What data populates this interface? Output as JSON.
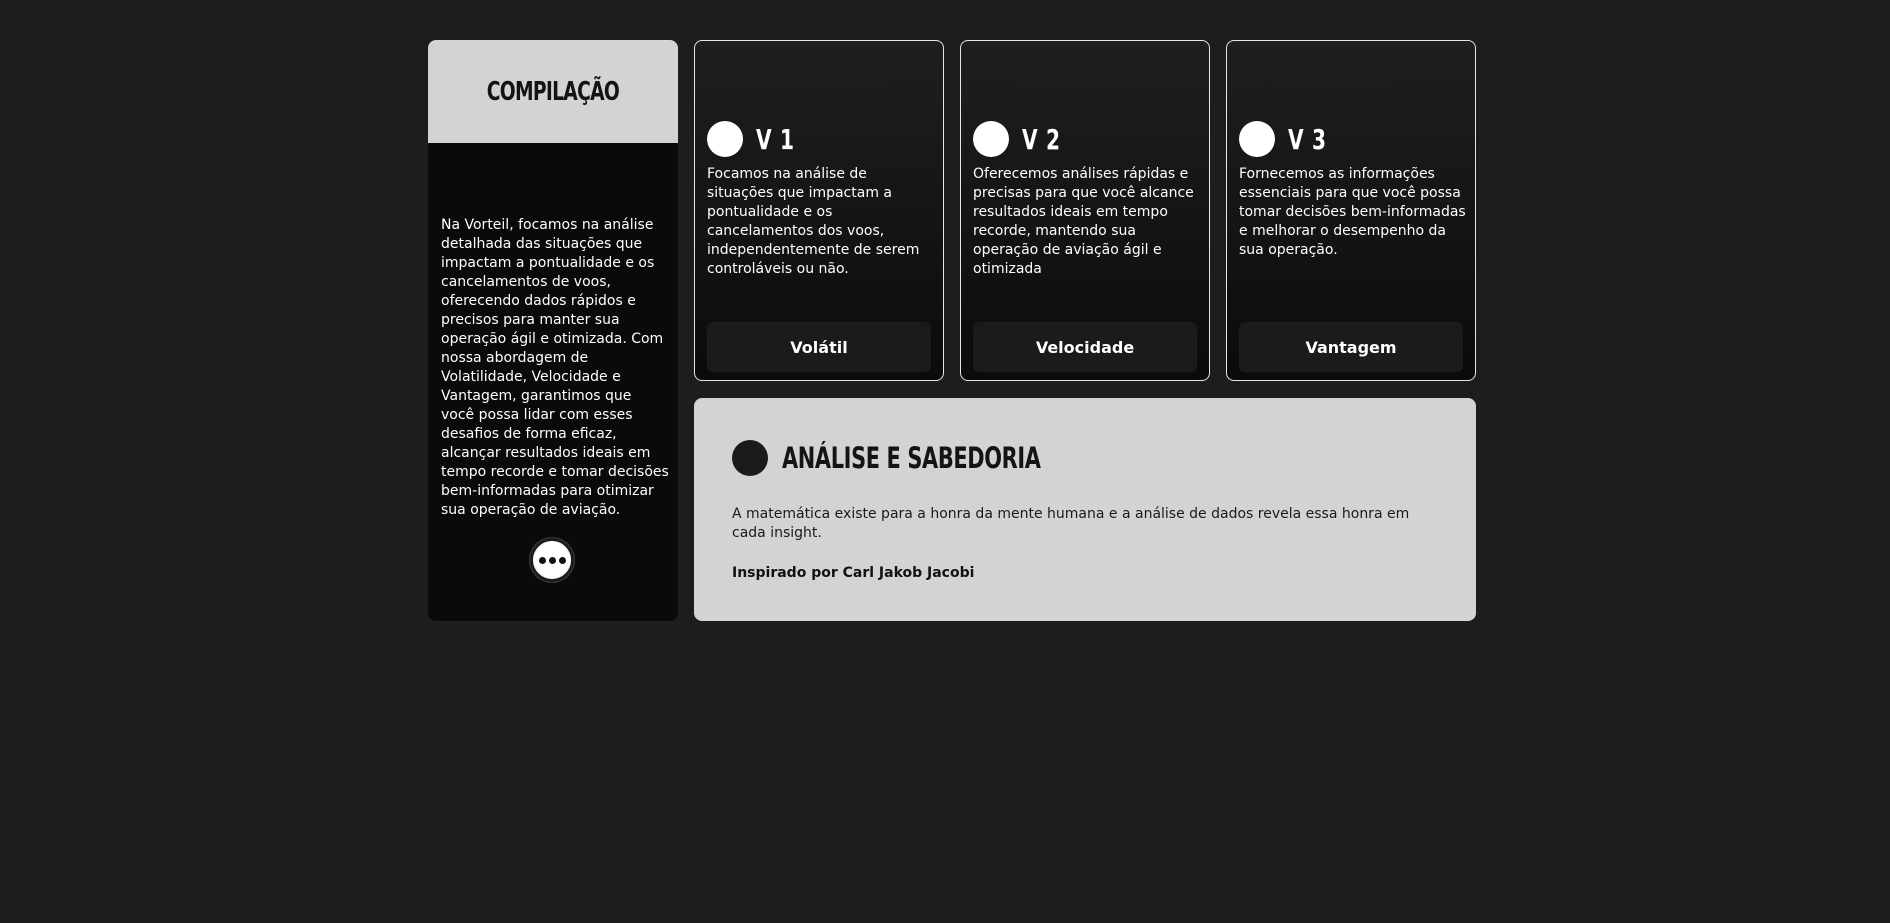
{
  "compilacao": {
    "title": "COMPILAÇÃO",
    "text": "Na Vorteil, focamos na análise detalhada das situações que impactam a pontualidade e os cancelamentos de voos, oferecendo dados rápidos e precisos para manter sua operação ágil e otimizada. Com nossa abordagem de Volatilidade, Velocidade e Vantagem, garantimos que você possa lidar com esses desafios de forma eficaz, alcançar resultados ideais em tempo recorde e tomar decisões bem-informadas para otimizar sua operação de aviação.",
    "more_icon": "more-horizontal-icon"
  },
  "cards": [
    {
      "title": "V 1",
      "text": "Focamos na análise de situações que impactam a pontualidade e os cancelamentos dos voos, independentemente de serem controláveis ou não.",
      "button": "Volátil"
    },
    {
      "title": "V 2",
      "text": "Oferecemos análises rápidas e precisas para que você alcance resultados ideais em tempo recorde, mantendo sua operação de aviação ágil e otimizada",
      "button": "Velocidade"
    },
    {
      "title": "V 3",
      "text": "Fornecemos as informações essenciais para que você possa tomar decisões bem-informadas e melhorar o desempenho da sua operação.",
      "button": "Vantagem"
    }
  ],
  "analise": {
    "title": "ANÁLISE E SABEDORIA",
    "quote": "A matemática existe para a honra da mente humana e a análise de dados revela essa honra em cada insight.",
    "credit": "Inspirado por Carl Jakob Jacobi"
  },
  "colors": {
    "page_bg": "#1d1d1d",
    "light_panel": "#d3d3d3",
    "dark_panel": "#0a0a0a",
    "button_bg": "#1b1b1b"
  }
}
